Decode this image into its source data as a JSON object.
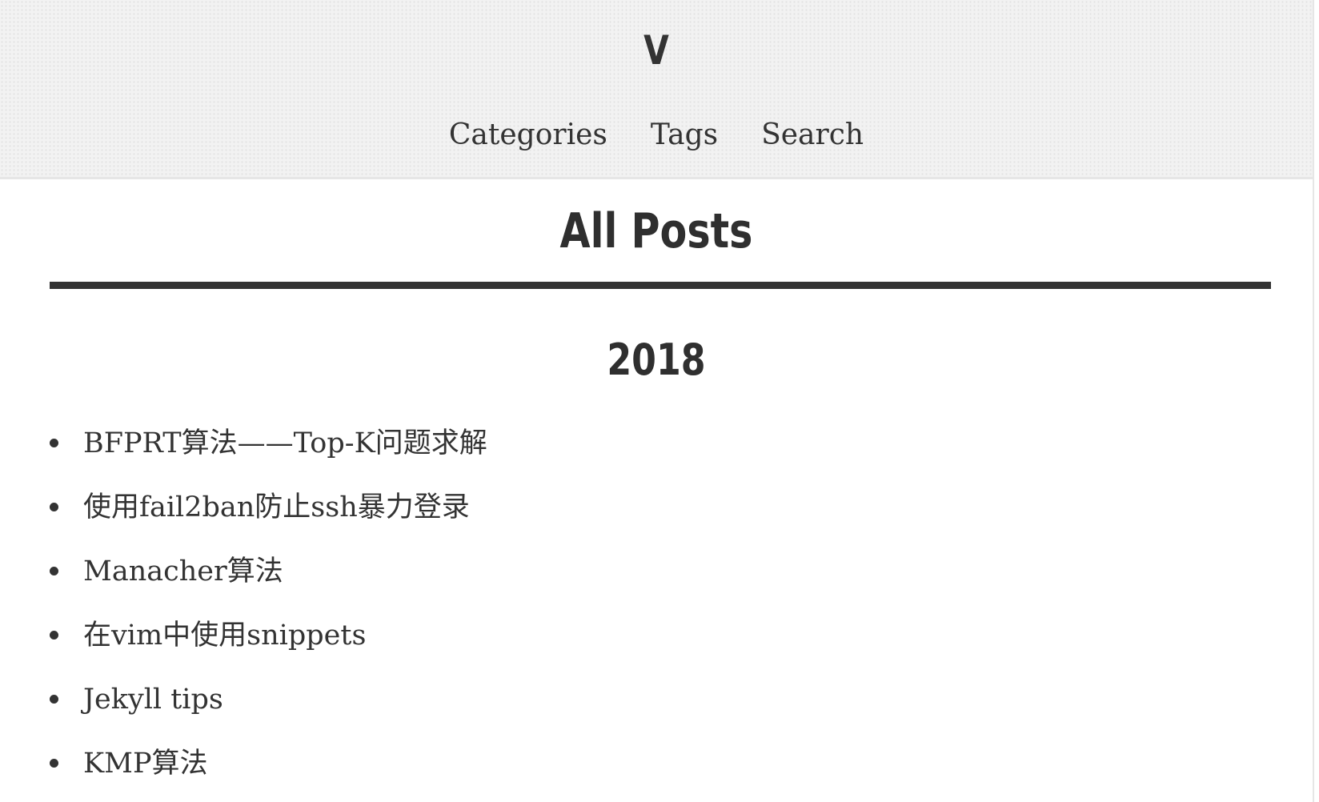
{
  "header": {
    "site_title": "V",
    "nav": [
      {
        "label": "Categories"
      },
      {
        "label": "Tags"
      },
      {
        "label": "Search"
      }
    ]
  },
  "main": {
    "page_title": "All Posts",
    "years": [
      {
        "year": "2018",
        "posts": [
          {
            "title": "BFPRT算法——Top-K问题求解"
          },
          {
            "title": "使用fail2ban防止ssh暴力登录"
          },
          {
            "title": "Manacher算法"
          },
          {
            "title": "在vim中使用snippets"
          },
          {
            "title": "Jekyll tips"
          },
          {
            "title": "KMP算法"
          }
        ]
      }
    ]
  }
}
